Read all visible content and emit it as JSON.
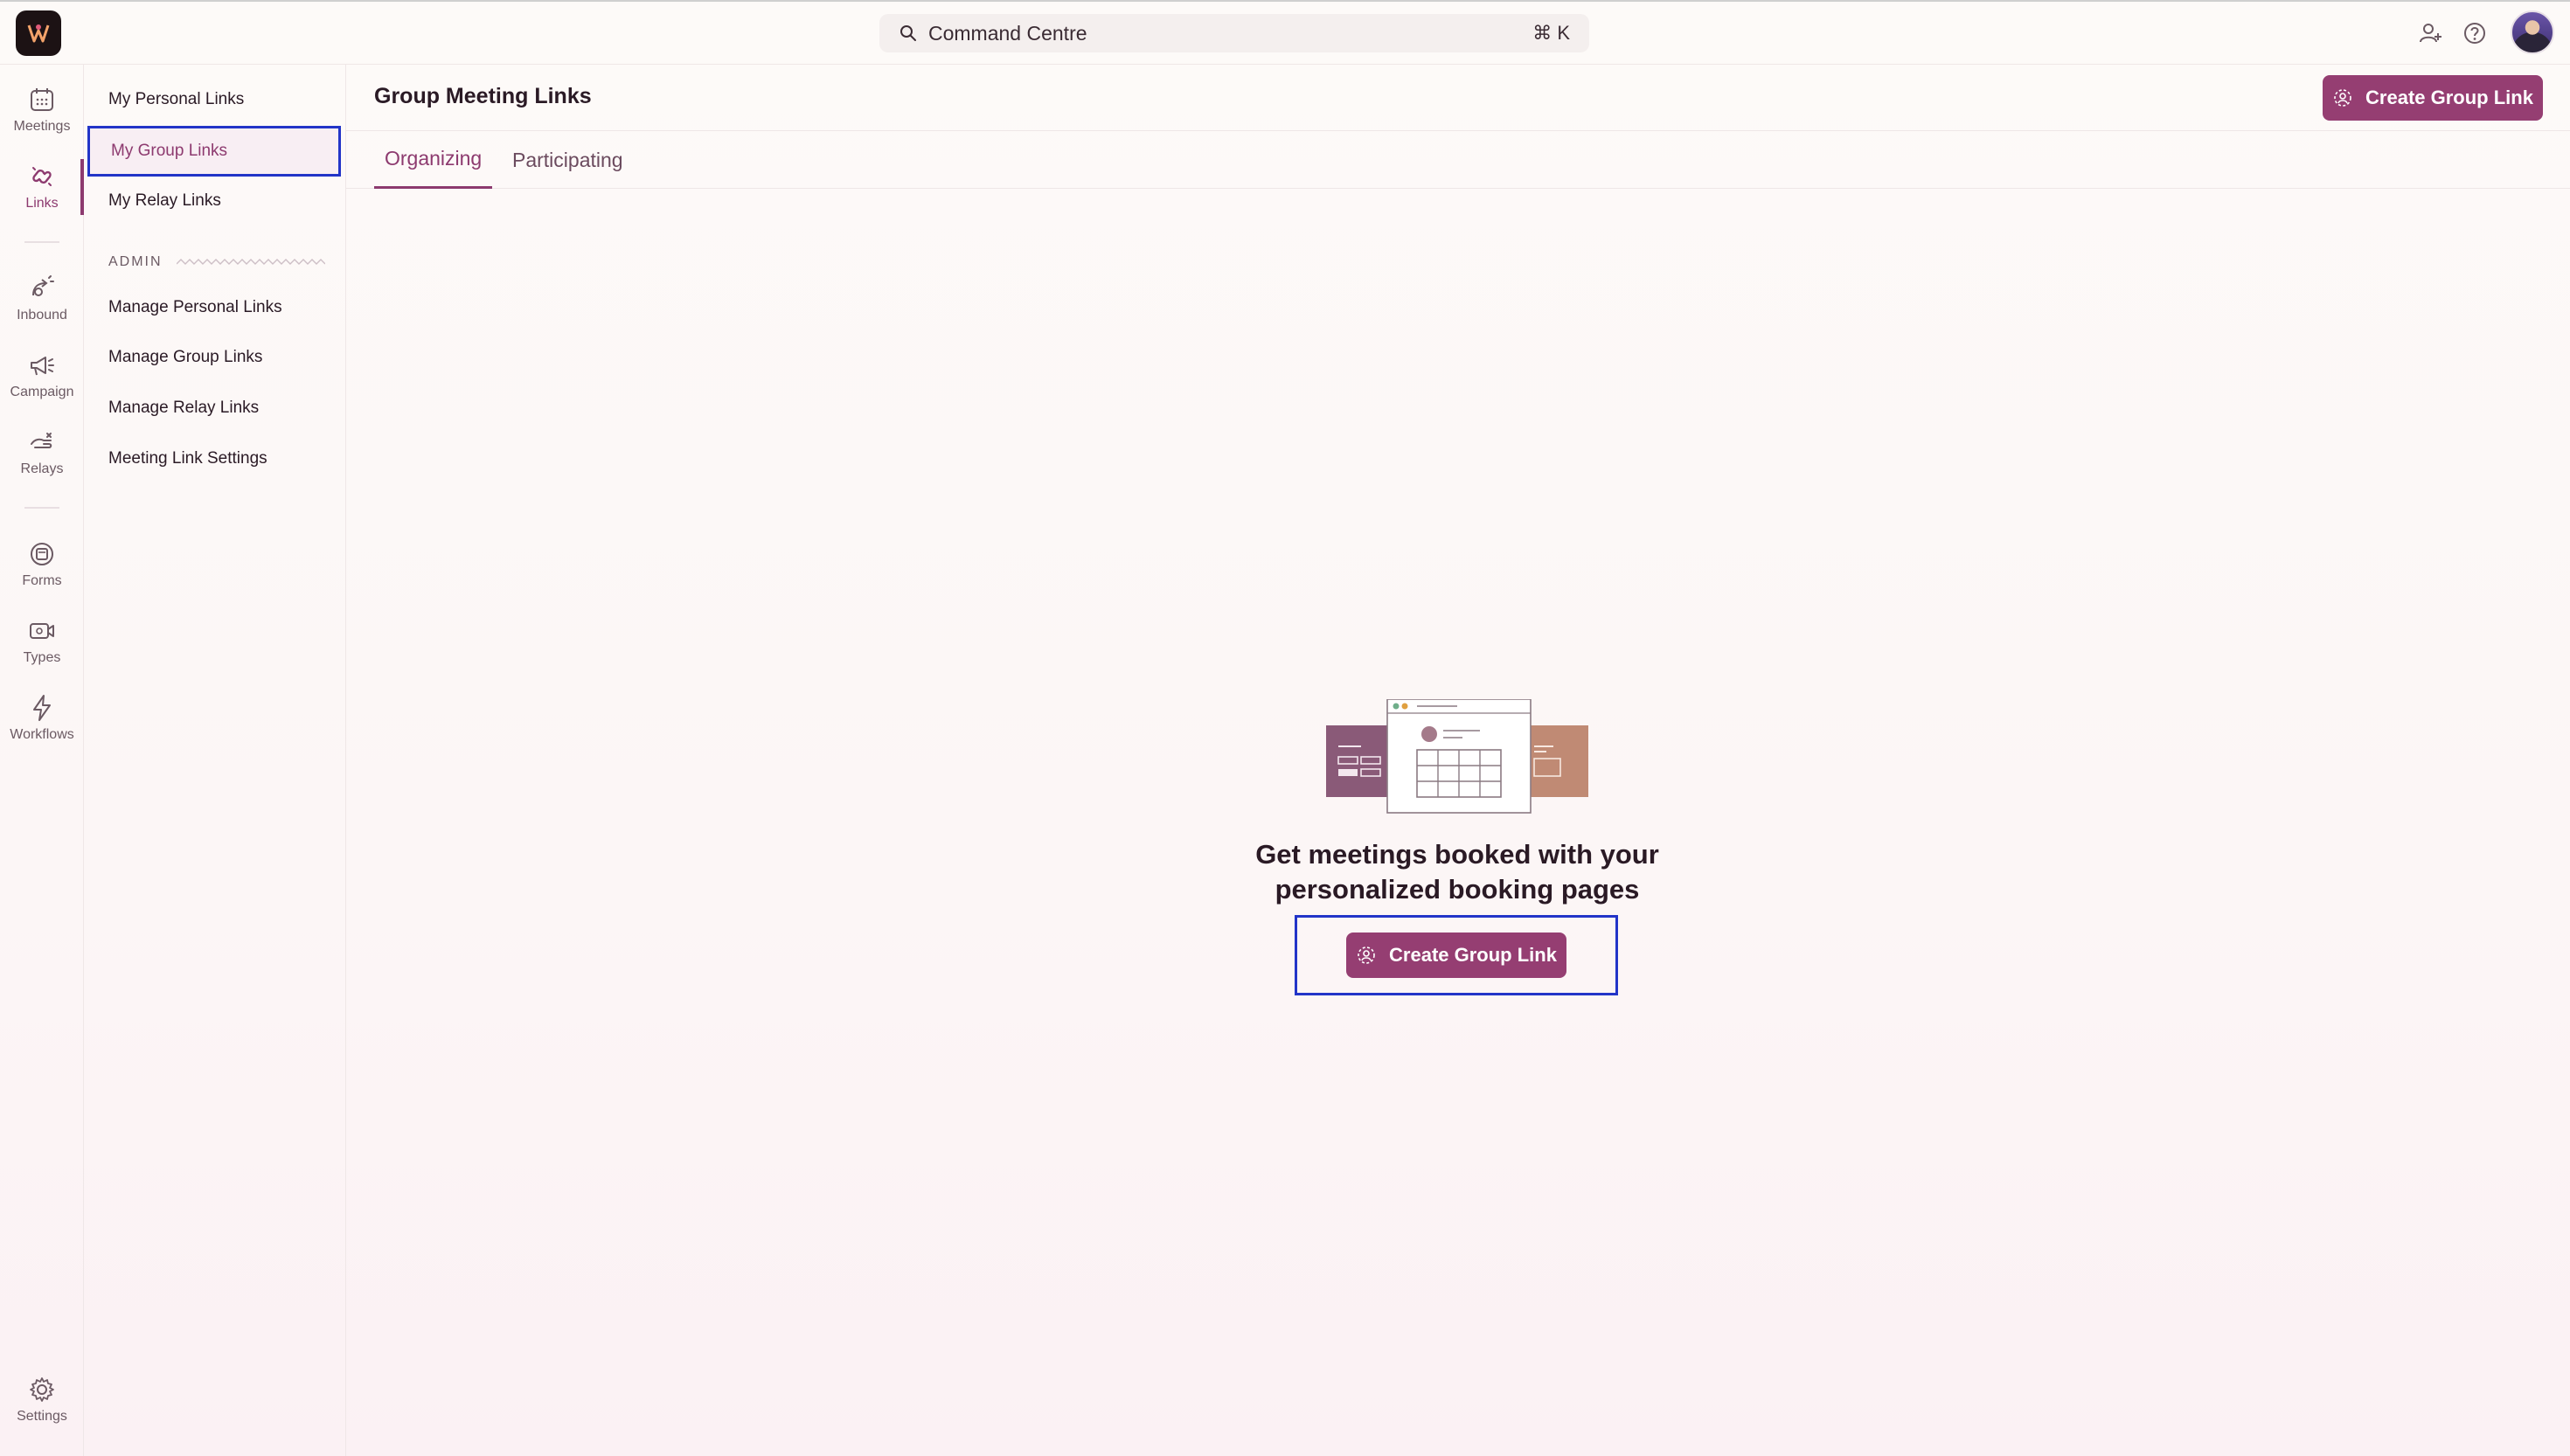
{
  "topbar": {
    "search_label": "Command Centre",
    "search_shortcut": "⌘ K",
    "icons": [
      "search-icon",
      "user-plus-icon",
      "help-icon"
    ]
  },
  "rail": {
    "items": [
      {
        "label": "Meetings",
        "icon": "calendar-icon"
      },
      {
        "label": "Links",
        "icon": "link-icon"
      },
      {
        "label": "Inbound",
        "icon": "inbound-icon"
      },
      {
        "label": "Campaign",
        "icon": "megaphone-icon"
      },
      {
        "label": "Relays",
        "icon": "relay-icon"
      },
      {
        "label": "Forms",
        "icon": "form-icon"
      },
      {
        "label": "Types",
        "icon": "video-icon"
      },
      {
        "label": "Workflows",
        "icon": "bolt-icon"
      },
      {
        "label": "Settings",
        "icon": "gear-icon"
      }
    ],
    "active": "Links"
  },
  "subnav": {
    "items": [
      {
        "label": "My Personal Links"
      },
      {
        "label": "My Group Links"
      },
      {
        "label": "My Relay Links"
      }
    ],
    "admin_heading": "ADMIN",
    "admin_items": [
      {
        "label": "Manage Personal Links"
      },
      {
        "label": "Manage Group Links"
      },
      {
        "label": "Manage Relay Links"
      },
      {
        "label": "Meeting Link Settings"
      }
    ],
    "active": "My Group Links"
  },
  "main": {
    "title": "Group Meeting Links",
    "create_button_label": "Create Group Link",
    "tabs": [
      {
        "label": "Organizing"
      },
      {
        "label": "Participating"
      }
    ],
    "active_tab": "Organizing",
    "empty_state": {
      "title_line1": "Get meetings booked with your",
      "title_line2": "personalized booking pages",
      "button_label": "Create Group Link"
    }
  },
  "colors": {
    "brand": "#953e72",
    "accent_text": "#8d3a6f",
    "focus_outline": "#2234c8"
  }
}
